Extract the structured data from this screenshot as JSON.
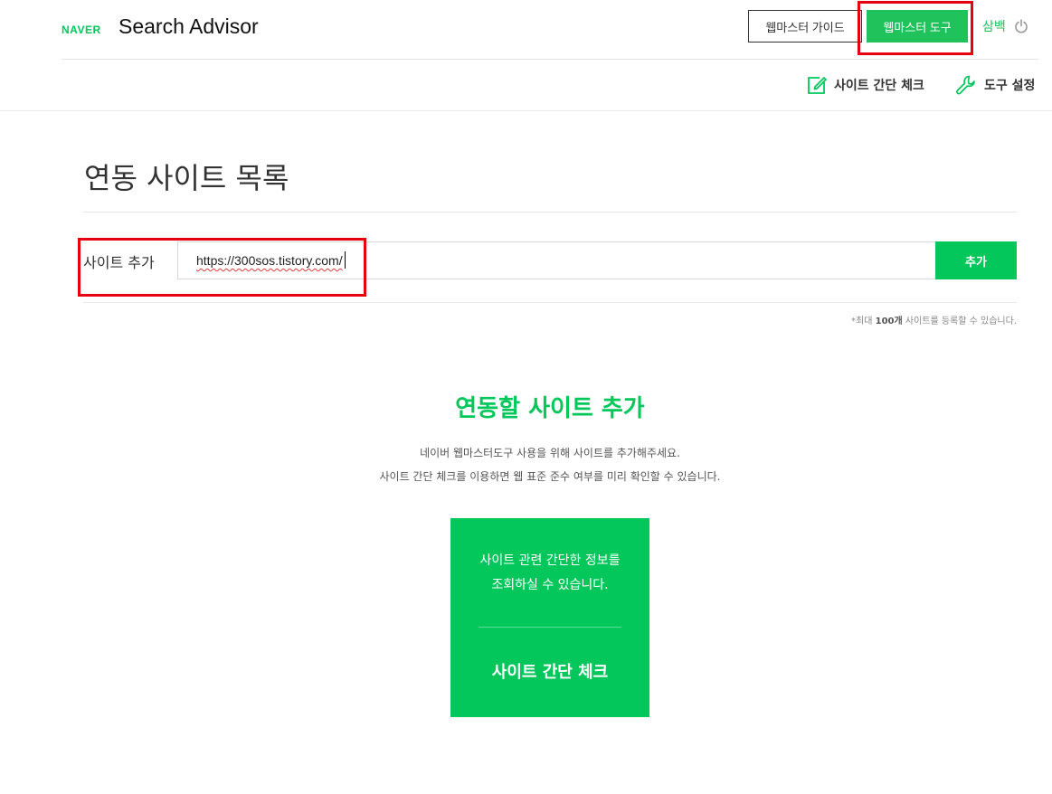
{
  "header": {
    "logo_brand": "NAVER",
    "logo_title": "Search Advisor",
    "guide_label": "웹마스터 가이드",
    "tools_label": "웹마스터 도구",
    "user_name": "삼백",
    "power_icon": "power-icon"
  },
  "subnav": {
    "check_label": "사이트 간단 체크",
    "check_icon": "edit-icon",
    "settings_label": "도구 설정",
    "settings_icon": "wrench-icon"
  },
  "main": {
    "title": "연동 사이트 목록",
    "add_label": "사이트 추가",
    "url_value": "https://300sos.tistory.com/",
    "add_button": "추가",
    "note_prefix": "*최대 ",
    "note_count": "100개",
    "note_suffix": " 사이트를 등록할 수 있습니다."
  },
  "empty_state": {
    "title": "연동할 사이트 추가",
    "desc_line1": "네이버 웹마스터도구 사용을 위해 사이트를 추가해주세요.",
    "desc_line2": "사이트 간단 체크를 이용하면 웹 표준 준수 여부를 미리 확인할 수 있습니다.",
    "card_line1": "사이트 관련 간단한 정보를",
    "card_line2": "조회하실 수 있습니다.",
    "card_title": "사이트 간단 체크"
  },
  "colors": {
    "brand_green": "#03c75a",
    "highlight_red": "#e60012"
  }
}
